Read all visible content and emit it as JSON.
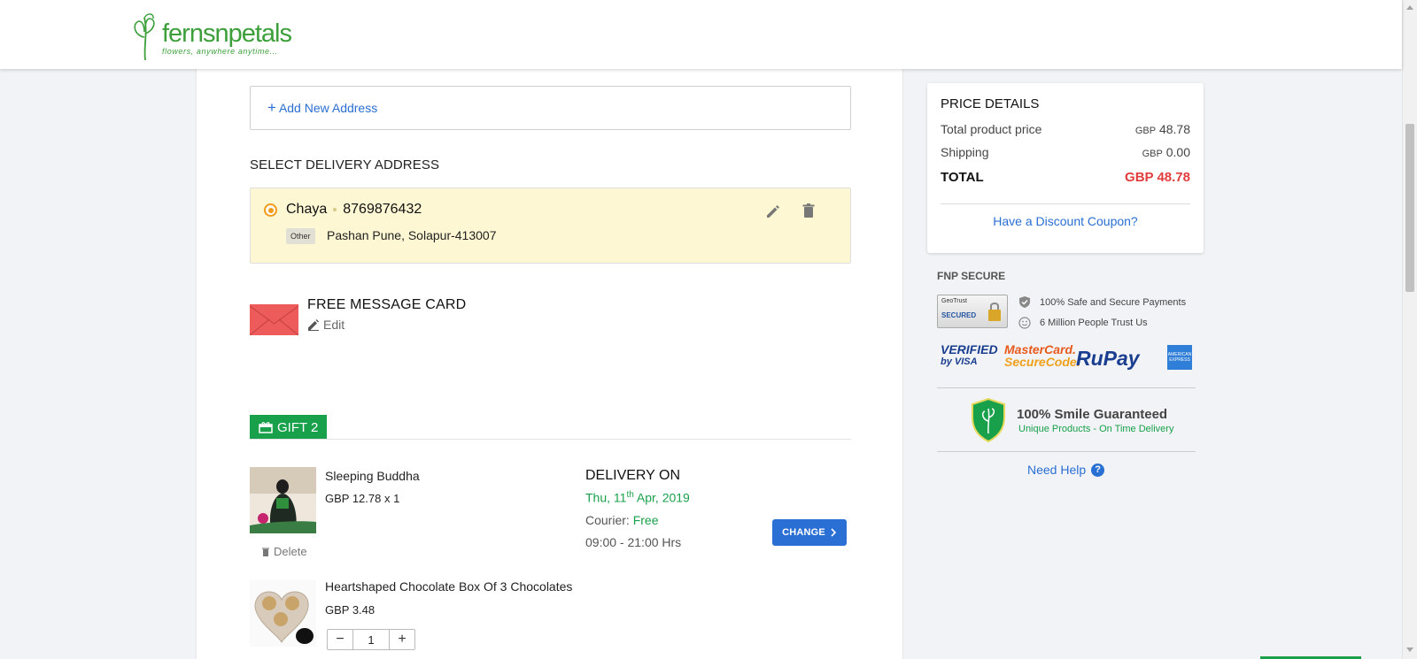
{
  "brand": {
    "name": "fernsnpetals",
    "tagline": "flowers, anywhere anytime..."
  },
  "address": {
    "add_label": "Add New Address",
    "section_title": "SELECT DELIVERY ADDRESS",
    "selected": {
      "name": "Chaya",
      "phone": "8769876432",
      "tag": "Other",
      "line": "Pashan Pune, Solapur-413007"
    }
  },
  "message_card": {
    "title": "FREE MESSAGE CARD",
    "edit_label": "Edit"
  },
  "gift": {
    "label": "GIFT 2",
    "items": [
      {
        "name": "Sleeping Buddha",
        "price": "GBP 12.78 x 1",
        "delete_label": "Delete"
      },
      {
        "name": "Heartshaped Chocolate Box Of 3 Chocolates",
        "price": "GBP 3.48",
        "quantity": "1"
      }
    ],
    "delivery": {
      "title": "DELIVERY ON",
      "date_day": "Thu, 11",
      "date_suffix": "th",
      "date_rest": " Apr, 2019",
      "courier_label": "Courier:",
      "courier_value": "Free",
      "time": "09:00 - 21:00 Hrs",
      "change_label": "CHANGE"
    }
  },
  "price_details": {
    "title": "PRICE DETAILS",
    "rows": [
      {
        "label": "Total product price",
        "currency": "GBP",
        "amount": "48.78"
      },
      {
        "label": "Shipping",
        "currency": "GBP",
        "amount": "0.00"
      }
    ],
    "total_label": "TOTAL",
    "total_value": "GBP 48.78",
    "coupon_label": "Have a Discount Coupon?"
  },
  "secure": {
    "title": "FNP SECURE",
    "geotrust_top": "GeoTrust",
    "geotrust_label": "SECURED",
    "lines": [
      "100% Safe and Secure Payments",
      "6 Million People Trust Us"
    ],
    "payment_logos": {
      "visa_top": "VERIFIED",
      "visa_bottom": "by VISA",
      "mc_top": "MasterCard.",
      "mc_bottom": "SecureCode.",
      "rupay": "RuPay",
      "amex": "AMERICAN EXPRESS"
    },
    "smile_title": "100% Smile Guaranteed",
    "smile_sub": "Unique Products - On Time Delivery",
    "help_label": "Need Help"
  },
  "colors": {
    "accent_blue": "#2a6fd4",
    "green": "#19a04b",
    "total_red": "#e23c3c",
    "radio_orange": "#f29b1a"
  }
}
